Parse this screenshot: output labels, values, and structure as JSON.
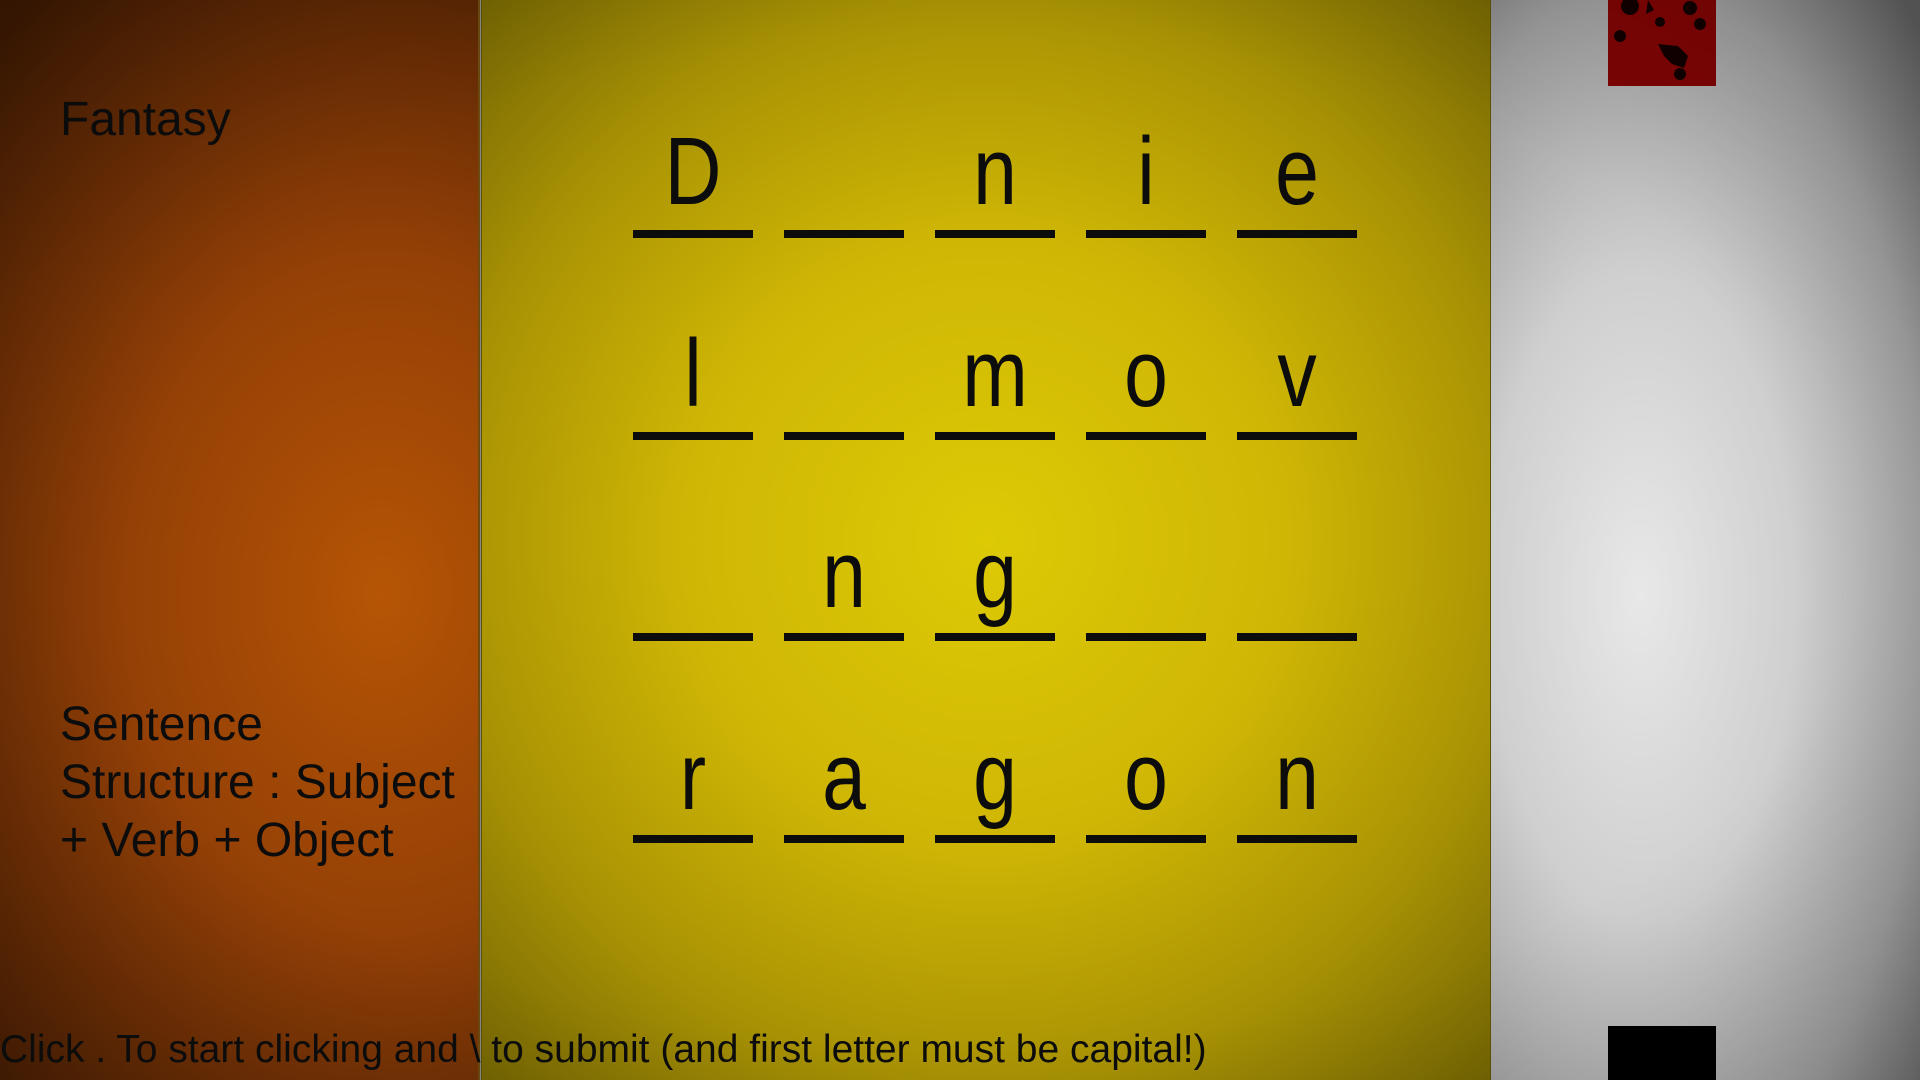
{
  "game": {
    "category": "Fantasy",
    "sentence_structure": "Sentence Structure : Subject + Verb + Object",
    "instructions": "Click . To start clicking and \\ to submit (and first letter must be capital!)"
  },
  "grid": {
    "rows": [
      [
        "D",
        "",
        "n",
        "i",
        "e"
      ],
      [
        "l",
        "",
        "m",
        "o",
        "v"
      ],
      [
        "",
        "n",
        "g",
        "",
        ""
      ],
      [
        "r",
        "a",
        "g",
        "o",
        "n"
      ]
    ]
  },
  "colors": {
    "left_panel": "#a84b06",
    "center_panel": "#d4bf05",
    "right_panel": "#cfcfcf",
    "red_tile": "#7c0404",
    "black_tile": "#000000",
    "text": "#0c0c0c"
  },
  "icons": {
    "red_tile": "splatter-icon"
  }
}
